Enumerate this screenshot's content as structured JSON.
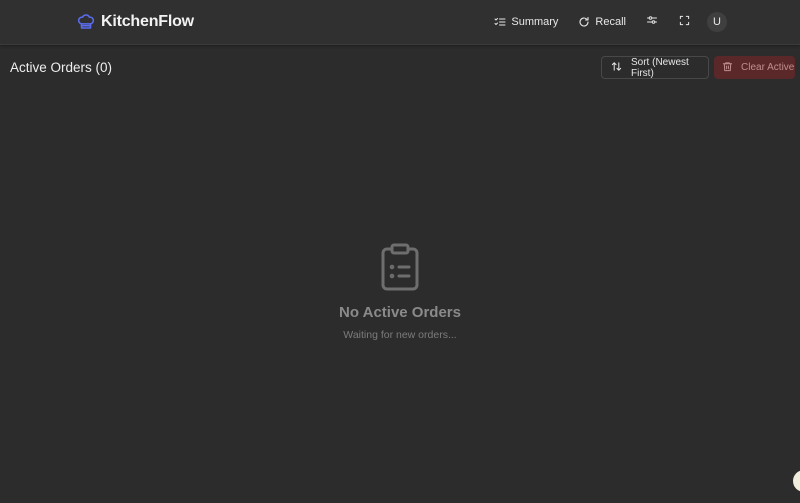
{
  "app": {
    "name": "KitchenFlow"
  },
  "topbar": {
    "summary_label": "Summary",
    "recall_label": "Recall",
    "avatar_initial": "U"
  },
  "orders": {
    "title": "Active Orders (0)",
    "sort_label": "Sort (Newest First)",
    "clear_label": "Clear Active"
  },
  "empty_state": {
    "title": "No Active Orders",
    "subtitle": "Waiting for new orders..."
  },
  "colors": {
    "background": "#2c2c2c",
    "topbar": "#303030",
    "brand_icon": "#5b6cf0",
    "danger_button": "#5a2828"
  },
  "icons": [
    "chef-hat-icon",
    "list-check-icon",
    "rotate-icon",
    "sliders-icon",
    "fullscreen-icon",
    "moon-icon",
    "sort-arrows-icon",
    "trash-icon",
    "clipboard-list-icon"
  ]
}
